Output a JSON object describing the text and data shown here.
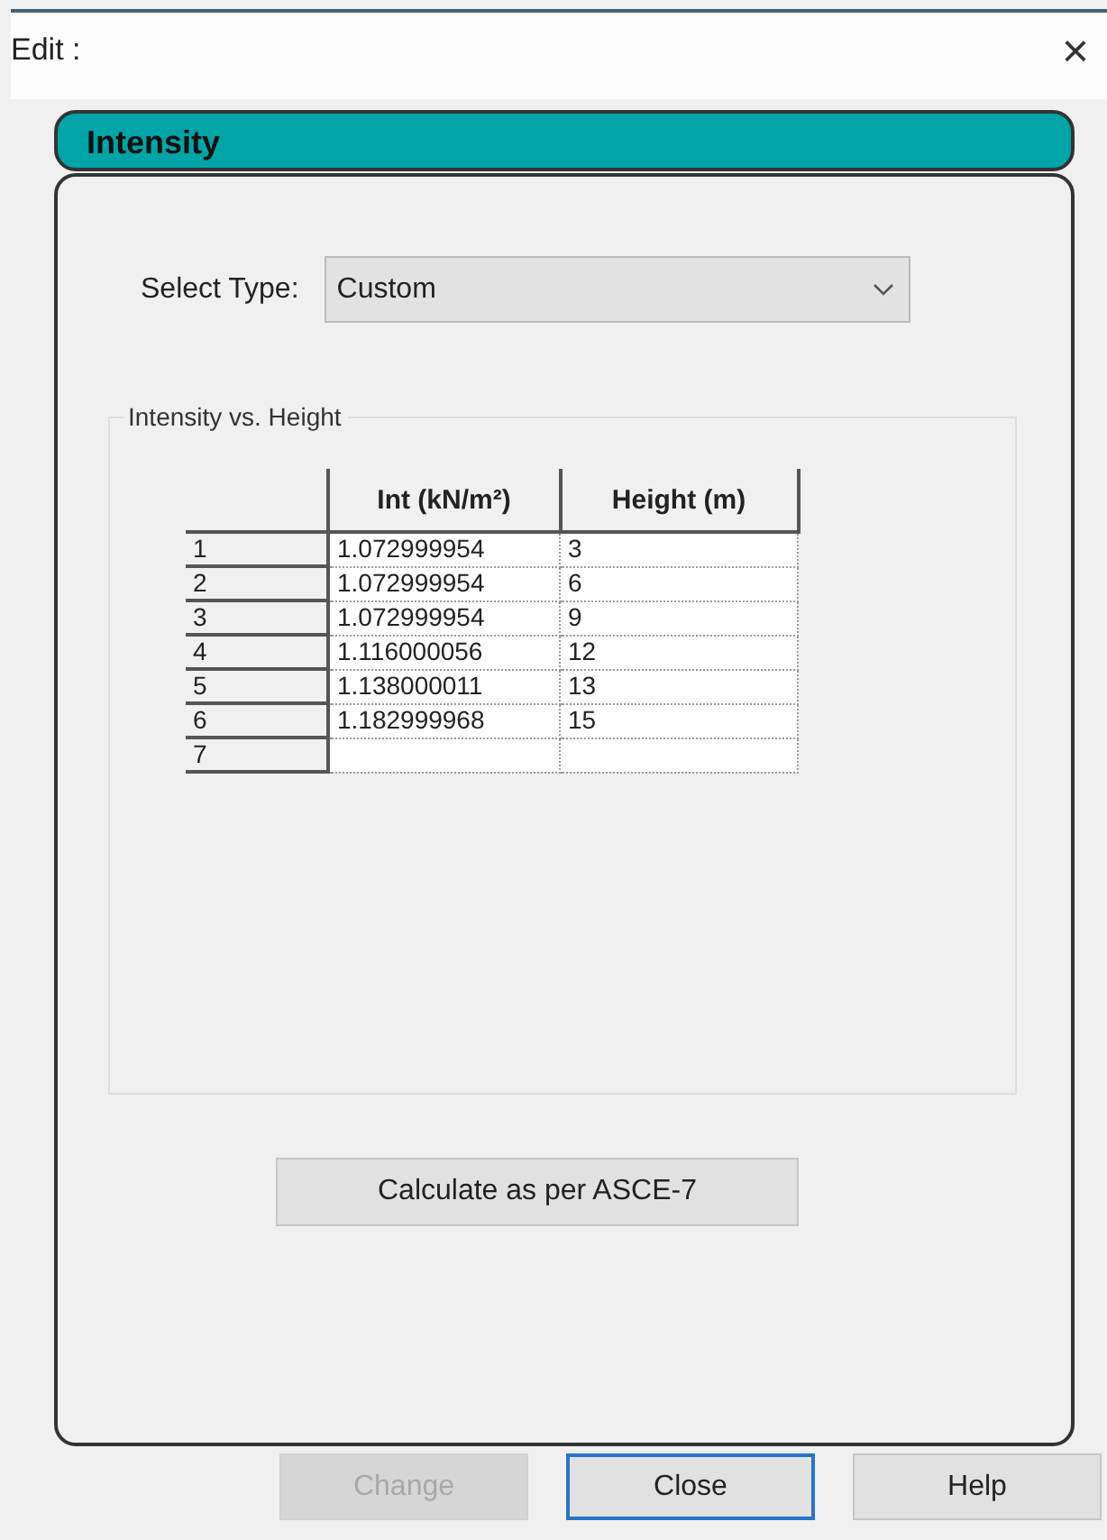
{
  "window": {
    "title": "Edit :",
    "close": "×"
  },
  "panel": {
    "title": "Intensity"
  },
  "select_type": {
    "label": "Select Type:",
    "value": "Custom"
  },
  "group": {
    "title": "Intensity vs. Height"
  },
  "table": {
    "columns": [
      "Int (kN/m²)",
      "Height (m)"
    ],
    "rows": [
      {
        "index": "1",
        "cells": [
          "1.072999954",
          "3"
        ]
      },
      {
        "index": "2",
        "cells": [
          "1.072999954",
          "6"
        ]
      },
      {
        "index": "3",
        "cells": [
          "1.072999954",
          "9"
        ]
      },
      {
        "index": "4",
        "cells": [
          "1.116000056",
          "12"
        ]
      },
      {
        "index": "5",
        "cells": [
          "1.138000011",
          "13"
        ]
      },
      {
        "index": "6",
        "cells": [
          "1.182999968",
          "15"
        ]
      },
      {
        "index": "7",
        "cells": []
      }
    ]
  },
  "calculate_button": {
    "label": "Calculate as per ASCE-7"
  },
  "buttons": [
    {
      "label": "Change",
      "disabled": true,
      "focused": false
    },
    {
      "label": "Close",
      "disabled": false,
      "focused": true
    },
    {
      "label": "Help",
      "disabled": false,
      "focused": false
    }
  ]
}
